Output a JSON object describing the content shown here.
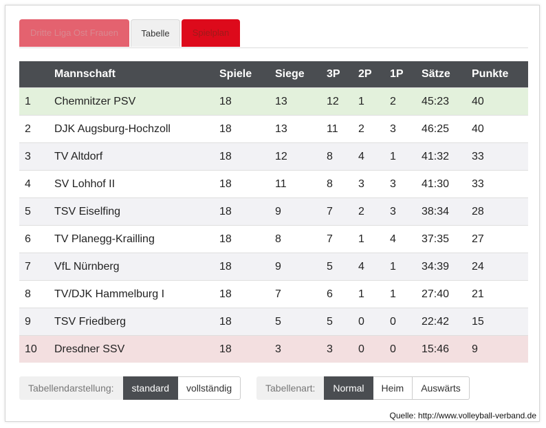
{
  "tabs": [
    {
      "label": "Dritte Liga Ost Frauen"
    },
    {
      "label": "Tabelle"
    },
    {
      "label": "Spielplan"
    }
  ],
  "table": {
    "headers": {
      "rank": "",
      "team": "Mannschaft",
      "games": "Spiele",
      "wins": "Siege",
      "p3": "3P",
      "p2": "2P",
      "p1": "1P",
      "sets": "Sätze",
      "points": "Punkte"
    },
    "rows": [
      {
        "rank": "1",
        "team": "Chemnitzer PSV",
        "games": "18",
        "wins": "13",
        "p3": "12",
        "p2": "1",
        "p1": "2",
        "sets": "45:23",
        "points": "40"
      },
      {
        "rank": "2",
        "team": "DJK Augsburg-Hochzoll",
        "games": "18",
        "wins": "13",
        "p3": "11",
        "p2": "2",
        "p1": "3",
        "sets": "46:25",
        "points": "40"
      },
      {
        "rank": "3",
        "team": "TV Altdorf",
        "games": "18",
        "wins": "12",
        "p3": "8",
        "p2": "4",
        "p1": "1",
        "sets": "41:32",
        "points": "33"
      },
      {
        "rank": "4",
        "team": "SV Lohhof II",
        "games": "18",
        "wins": "11",
        "p3": "8",
        "p2": "3",
        "p1": "3",
        "sets": "41:30",
        "points": "33"
      },
      {
        "rank": "5",
        "team": "TSV Eiselfing",
        "games": "18",
        "wins": "9",
        "p3": "7",
        "p2": "2",
        "p1": "3",
        "sets": "38:34",
        "points": "28"
      },
      {
        "rank": "6",
        "team": "TV Planegg-Krailling",
        "games": "18",
        "wins": "8",
        "p3": "7",
        "p2": "1",
        "p1": "4",
        "sets": "37:35",
        "points": "27"
      },
      {
        "rank": "7",
        "team": "VfL Nürnberg",
        "games": "18",
        "wins": "9",
        "p3": "5",
        "p2": "4",
        "p1": "1",
        "sets": "34:39",
        "points": "24"
      },
      {
        "rank": "8",
        "team": "TV/DJK Hammelburg I",
        "games": "18",
        "wins": "7",
        "p3": "6",
        "p2": "1",
        "p1": "1",
        "sets": "27:40",
        "points": "21"
      },
      {
        "rank": "9",
        "team": "TSV Friedberg",
        "games": "18",
        "wins": "5",
        "p3": "5",
        "p2": "0",
        "p1": "0",
        "sets": "22:42",
        "points": "15"
      },
      {
        "rank": "10",
        "team": "Dresdner SSV",
        "games": "18",
        "wins": "3",
        "p3": "3",
        "p2": "0",
        "p1": "0",
        "sets": "15:46",
        "points": "9"
      }
    ]
  },
  "display_controls": {
    "label": "Tabellendarstellung:",
    "options": [
      "standard",
      "vollständig"
    ],
    "selected": "standard"
  },
  "type_controls": {
    "label": "Tabellenart:",
    "options": [
      "Normal",
      "Heim",
      "Auswärts"
    ],
    "selected": "Normal"
  },
  "source": "Quelle: http://www.volleyball-verband.de",
  "colors": {
    "header_bg": "#4a4d51",
    "leader_row": "#e3f1dc",
    "relegation_row": "#f3dfe0",
    "tab_league": "#e4626f",
    "tab_schedule": "#dd0a1b"
  }
}
